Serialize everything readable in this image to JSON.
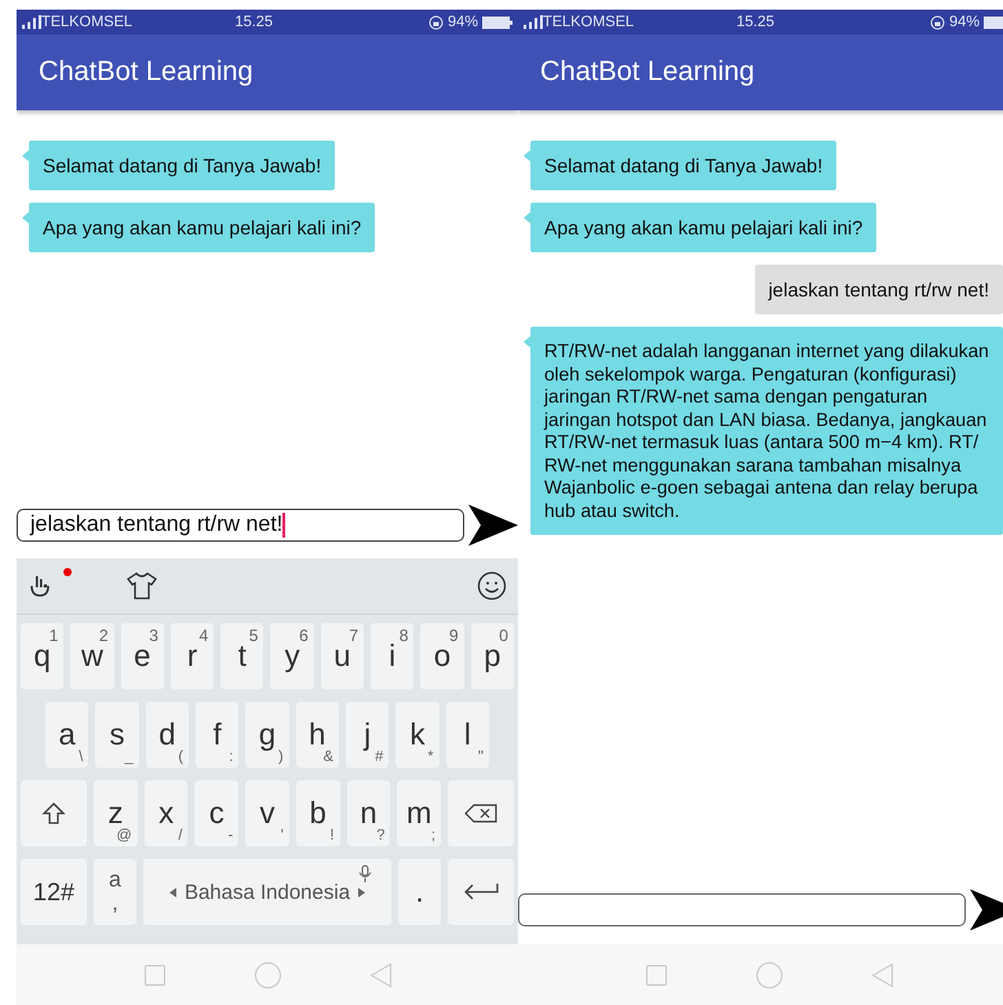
{
  "screens": [
    {
      "status_bar": {
        "carrier": "TELKOMSEL",
        "time": "15.25",
        "battery": "94%"
      },
      "app_bar": {
        "title": "ChatBot Learning"
      },
      "messages": [
        {
          "kind": "bot",
          "text": "Selamat datang di Tanya Jawab!"
        },
        {
          "kind": "bot",
          "text": "Apa yang akan kamu pelajari kali ini?"
        }
      ],
      "input": {
        "value": "jelaskan tentang rt/rw net!",
        "focused": true
      },
      "keyboard": {
        "notification": true,
        "rows": [
          {
            "keys": [
              {
                "kind": "char",
                "label": "q",
                "hint": "1"
              },
              {
                "kind": "char",
                "label": "w",
                "hint": "2"
              },
              {
                "kind": "char",
                "label": "e",
                "hint": "3"
              },
              {
                "kind": "char",
                "label": "r",
                "hint": "4"
              },
              {
                "kind": "char",
                "label": "t",
                "hint": "5"
              },
              {
                "kind": "char",
                "label": "y",
                "hint": "6"
              },
              {
                "kind": "char",
                "label": "u",
                "hint": "7"
              },
              {
                "kind": "char",
                "label": "i",
                "hint": "8"
              },
              {
                "kind": "char",
                "label": "o",
                "hint": "9"
              },
              {
                "kind": "char",
                "label": "p",
                "hint": "0"
              }
            ]
          },
          {
            "keys": [
              {
                "kind": "char",
                "label": "a",
                "hint": "\\"
              },
              {
                "kind": "char",
                "label": "s",
                "hint": "_"
              },
              {
                "kind": "char",
                "label": "d",
                "hint": "("
              },
              {
                "kind": "char",
                "label": "f",
                "hint": ":"
              },
              {
                "kind": "char",
                "label": "g",
                "hint": ")"
              },
              {
                "kind": "char",
                "label": "h",
                "hint": "&"
              },
              {
                "kind": "char",
                "label": "j",
                "hint": "#"
              },
              {
                "kind": "char",
                "label": "k",
                "hint": "*"
              },
              {
                "kind": "char",
                "label": "l",
                "hint": "\""
              }
            ]
          },
          {
            "keys": [
              {
                "kind": "shift"
              },
              {
                "kind": "char",
                "label": "z",
                "hint": "@"
              },
              {
                "kind": "char",
                "label": "x",
                "hint": "/"
              },
              {
                "kind": "char",
                "label": "c",
                "hint": "-"
              },
              {
                "kind": "char",
                "label": "v",
                "hint": "'"
              },
              {
                "kind": "char",
                "label": "b",
                "hint": "!"
              },
              {
                "kind": "char",
                "label": "n",
                "hint": "?"
              },
              {
                "kind": "char",
                "label": "m",
                "hint": ";"
              },
              {
                "kind": "backspace"
              }
            ]
          },
          {
            "keys": [
              {
                "kind": "mode",
                "label": "12#"
              },
              {
                "kind": "dual",
                "label": "a",
                "hint": ","
              },
              {
                "kind": "space",
                "label": "Bahasa Indonesia"
              },
              {
                "kind": "plain",
                "label": "."
              },
              {
                "kind": "enter"
              }
            ]
          }
        ]
      }
    },
    {
      "status_bar": {
        "carrier": "TELKOMSEL",
        "time": "15.25",
        "battery": "94%"
      },
      "app_bar": {
        "title": "ChatBot Learning"
      },
      "messages": [
        {
          "kind": "bot",
          "text": "Selamat datang di Tanya Jawab!"
        },
        {
          "kind": "bot",
          "text": "Apa yang akan kamu pelajari kali ini?"
        },
        {
          "kind": "user",
          "text": "jelaskan tentang rt/rw net!"
        },
        {
          "kind": "bot",
          "text": "RT/RW-net adalah langganan internet yang dilakukan oleh sekelompok warga. Pengaturan (konfigurasi) jaringan RT/RW-net sama dengan pengaturan jaringan hotspot dan LAN biasa. Bedanya, jangkauan RT/RW-net termasuk luas (antara 500 m−4 km). RT/ RW-net menggunakan sarana tambahan misalnya Wajanbolic e-goen sebagai antena dan relay berupa hub atau switch."
        }
      ],
      "input": {
        "focused": false
      }
    }
  ]
}
